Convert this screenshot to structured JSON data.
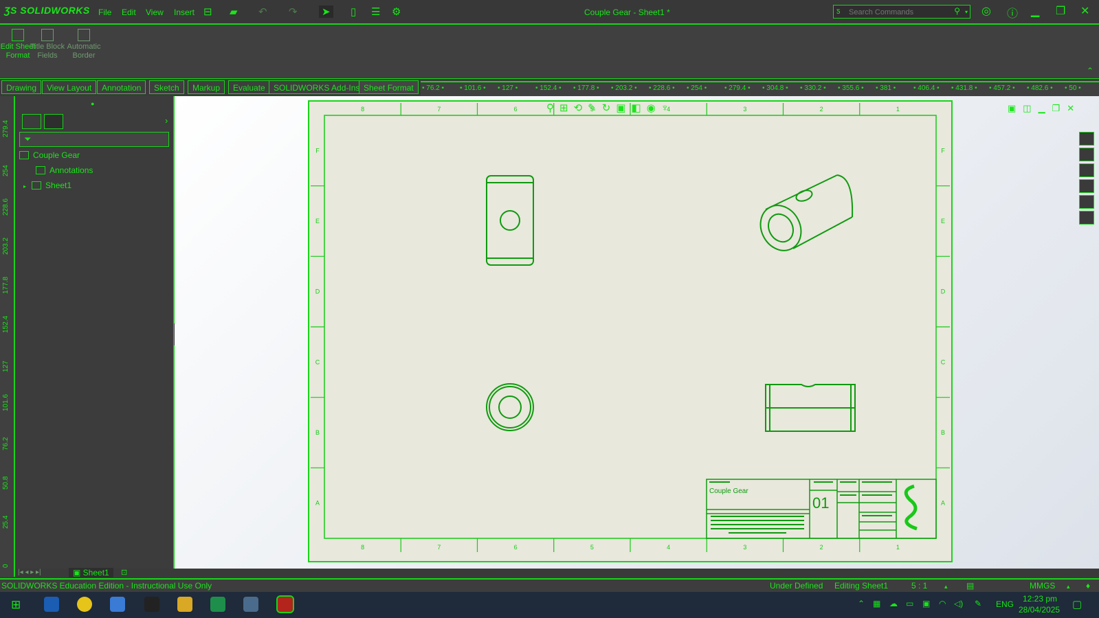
{
  "app": {
    "logo_text": "SOLIDWORKS",
    "document_title": "Couple Gear - Sheet1 *"
  },
  "menu": [
    "File",
    "Edit",
    "View",
    "Insert"
  ],
  "search": {
    "placeholder": "Search Commands"
  },
  "ribbon": {
    "buttons": [
      {
        "label": "Edit Sheet Format",
        "enabled": true
      },
      {
        "label": "Title Block Fields",
        "enabled": false
      },
      {
        "label": "Automatic Border",
        "enabled": false
      }
    ]
  },
  "tabs": [
    {
      "label": "Drawing"
    },
    {
      "label": "View Layout"
    },
    {
      "label": "Annotation"
    },
    {
      "label": "Sketch"
    },
    {
      "label": "Markup"
    },
    {
      "label": "Evaluate"
    },
    {
      "label": "SOLIDWORKS Add-Ins"
    },
    {
      "label": "Sheet Format",
      "active": true
    }
  ],
  "ruler": {
    "horizontal": [
      "76.2",
      "101.6",
      "127",
      "152.4",
      "177.8",
      "203.2",
      "228.6",
      "254",
      "279.4",
      "304.8",
      "330.2",
      "355.6",
      "381",
      "406.4",
      "431.8",
      "457.2",
      "482.6",
      "50"
    ],
    "vertical": [
      "279.4",
      "254",
      "228.6",
      "203.2",
      "177.8",
      "152.4",
      "127",
      "101.6",
      "76.2",
      "50.8",
      "25.4",
      "0"
    ]
  },
  "tree": {
    "root": "Couple Gear",
    "items": [
      "Annotations",
      "Sheet1"
    ]
  },
  "sheet": {
    "zone_columns": [
      "8",
      "7",
      "6",
      "5",
      "4",
      "3",
      "2",
      "1"
    ],
    "zone_rows": [
      "F",
      "E",
      "D",
      "C",
      "B",
      "A"
    ],
    "title_block": {
      "title": "Couple Gear",
      "sheet_number": "01"
    }
  },
  "sheet_tabs": [
    "Sheet1"
  ],
  "status": {
    "edition": "SOLIDWORKS Education Edition - Instructional Use Only",
    "definition": "Under Defined",
    "editing": "Editing Sheet1",
    "scale": "5 : 1",
    "units": "MMGS"
  },
  "taskbar": {
    "language": "ENG",
    "time": "12:23 pm",
    "date": "28/04/2025"
  },
  "colors": {
    "accent": "#19e619",
    "chrome": "#383838",
    "sheet": "#e8e8dc"
  }
}
